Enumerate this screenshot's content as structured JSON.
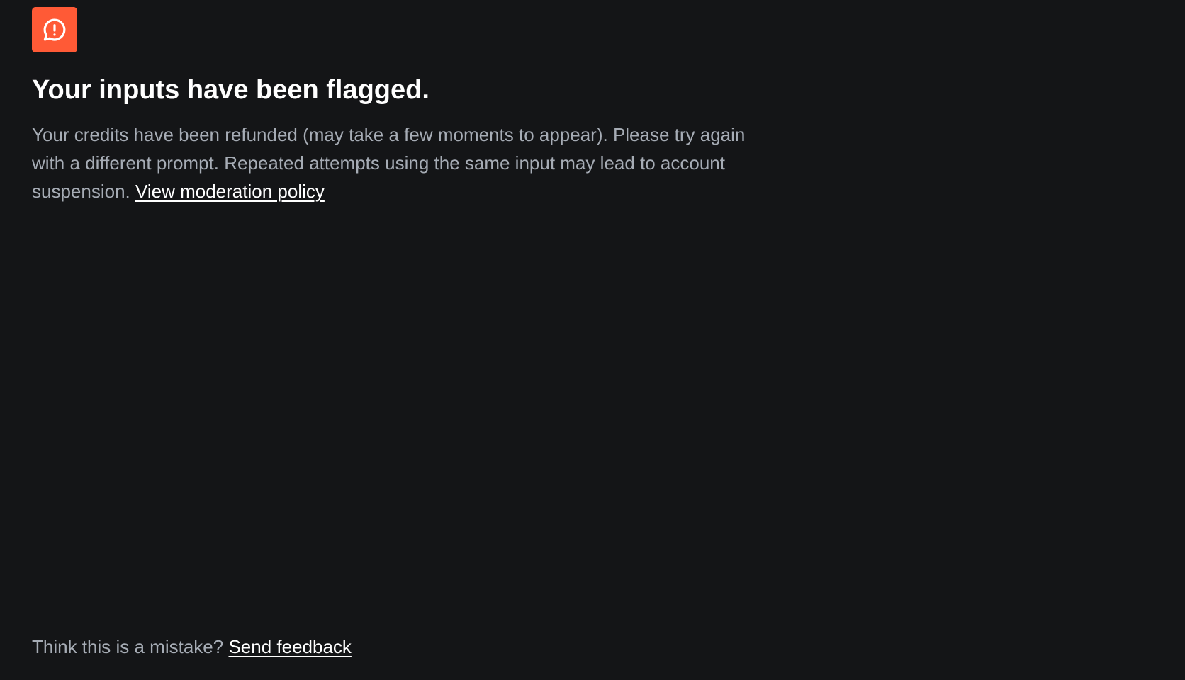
{
  "colors": {
    "background": "#141517",
    "accent": "#ff5a36",
    "heading": "#ffffff",
    "body_text": "#a6acb5",
    "link": "#ffffff"
  },
  "alert": {
    "icon": "chat-alert-icon"
  },
  "title": "Your inputs have been flagged.",
  "message": {
    "text": "Your credits have been refunded (may take a few moments to appear). Please try again with a different prompt. Repeated attempts using the same input may lead to account suspension.",
    "link_label": "View moderation policy"
  },
  "footer": {
    "prompt": "Think this is a mistake?",
    "link_label": "Send feedback"
  }
}
